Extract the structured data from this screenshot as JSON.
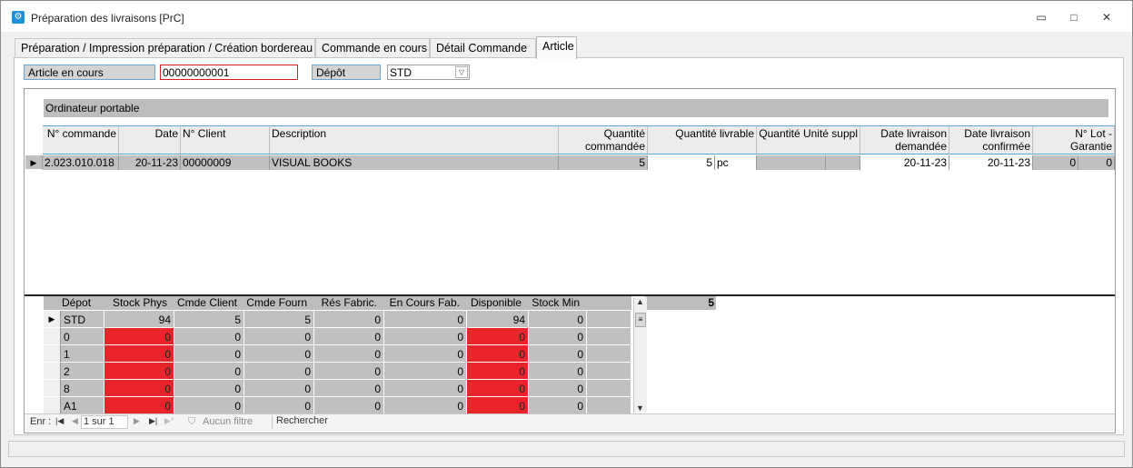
{
  "window": {
    "title": "Préparation des livraisons [PrC]",
    "icon": "app-icon",
    "controls": {
      "minimize": "▭",
      "maximize": "□",
      "close": "✕"
    }
  },
  "tabs": [
    {
      "label": "Préparation / Impression préparation / Création bordereau"
    },
    {
      "label": "Commande en cours"
    },
    {
      "label": "Détail Commande"
    },
    {
      "label": "Article",
      "active": true
    }
  ],
  "form": {
    "article_label": "Article en cours",
    "article_value": "00000000001",
    "depot_label": "Dépôt",
    "depot_value": "STD"
  },
  "product_name": "Ordinateur portable",
  "orders": {
    "headers": [
      "N° commande",
      "Date",
      "N° Client",
      "Description",
      "Quantité commandée",
      "Quantité livrable",
      "Quantité Unité suppl",
      "Date livraison demandée",
      "Date livraison confirmée",
      "N° Lot - Garantie"
    ],
    "rows": [
      {
        "no_commande": "2.023.010.018",
        "date": "20-11-23",
        "client": "00000009",
        "description": "VISUAL BOOKS",
        "qte_commandee": "5",
        "qte_livrable": "5",
        "unite": "pc",
        "qte_unite_suppl": "",
        "suppl2": "",
        "date_demandee": "20-11-23",
        "date_confirmee": "20-11-23",
        "lot1": "0",
        "lot2": "0"
      }
    ]
  },
  "stock": {
    "headers": [
      "Dépot",
      "Stock Phys",
      "Cmde Client",
      "Cmde Fourn",
      "Rés Fabric.",
      "En Cours Fab.",
      "Disponible",
      "Stock Min"
    ],
    "extra_value": "5",
    "rows": [
      {
        "depot": "STD",
        "values": [
          "94",
          "5",
          "5",
          "0",
          "0",
          "94",
          "0"
        ],
        "red": false
      },
      {
        "depot": "0",
        "values": [
          "0",
          "0",
          "0",
          "0",
          "0",
          "0",
          "0"
        ],
        "red": true
      },
      {
        "depot": "1",
        "values": [
          "0",
          "0",
          "0",
          "0",
          "0",
          "0",
          "0"
        ],
        "red": true
      },
      {
        "depot": "2",
        "values": [
          "0",
          "0",
          "0",
          "0",
          "0",
          "0",
          "0"
        ],
        "red": true
      },
      {
        "depot": "8",
        "values": [
          "0",
          "0",
          "0",
          "0",
          "0",
          "0",
          "0"
        ],
        "red": true
      },
      {
        "depot": "A1",
        "values": [
          "0",
          "0",
          "0",
          "0",
          "0",
          "0",
          "0"
        ],
        "red": true
      }
    ]
  },
  "nav": {
    "record_label": "Enr :",
    "position": "1 sur 1",
    "filter": "Aucun filtre",
    "search": "Rechercher"
  },
  "colors": {
    "red_cell": "#e9242a",
    "accent_border": "#5ba7d8",
    "grey_cell": "#c0c0c0"
  }
}
